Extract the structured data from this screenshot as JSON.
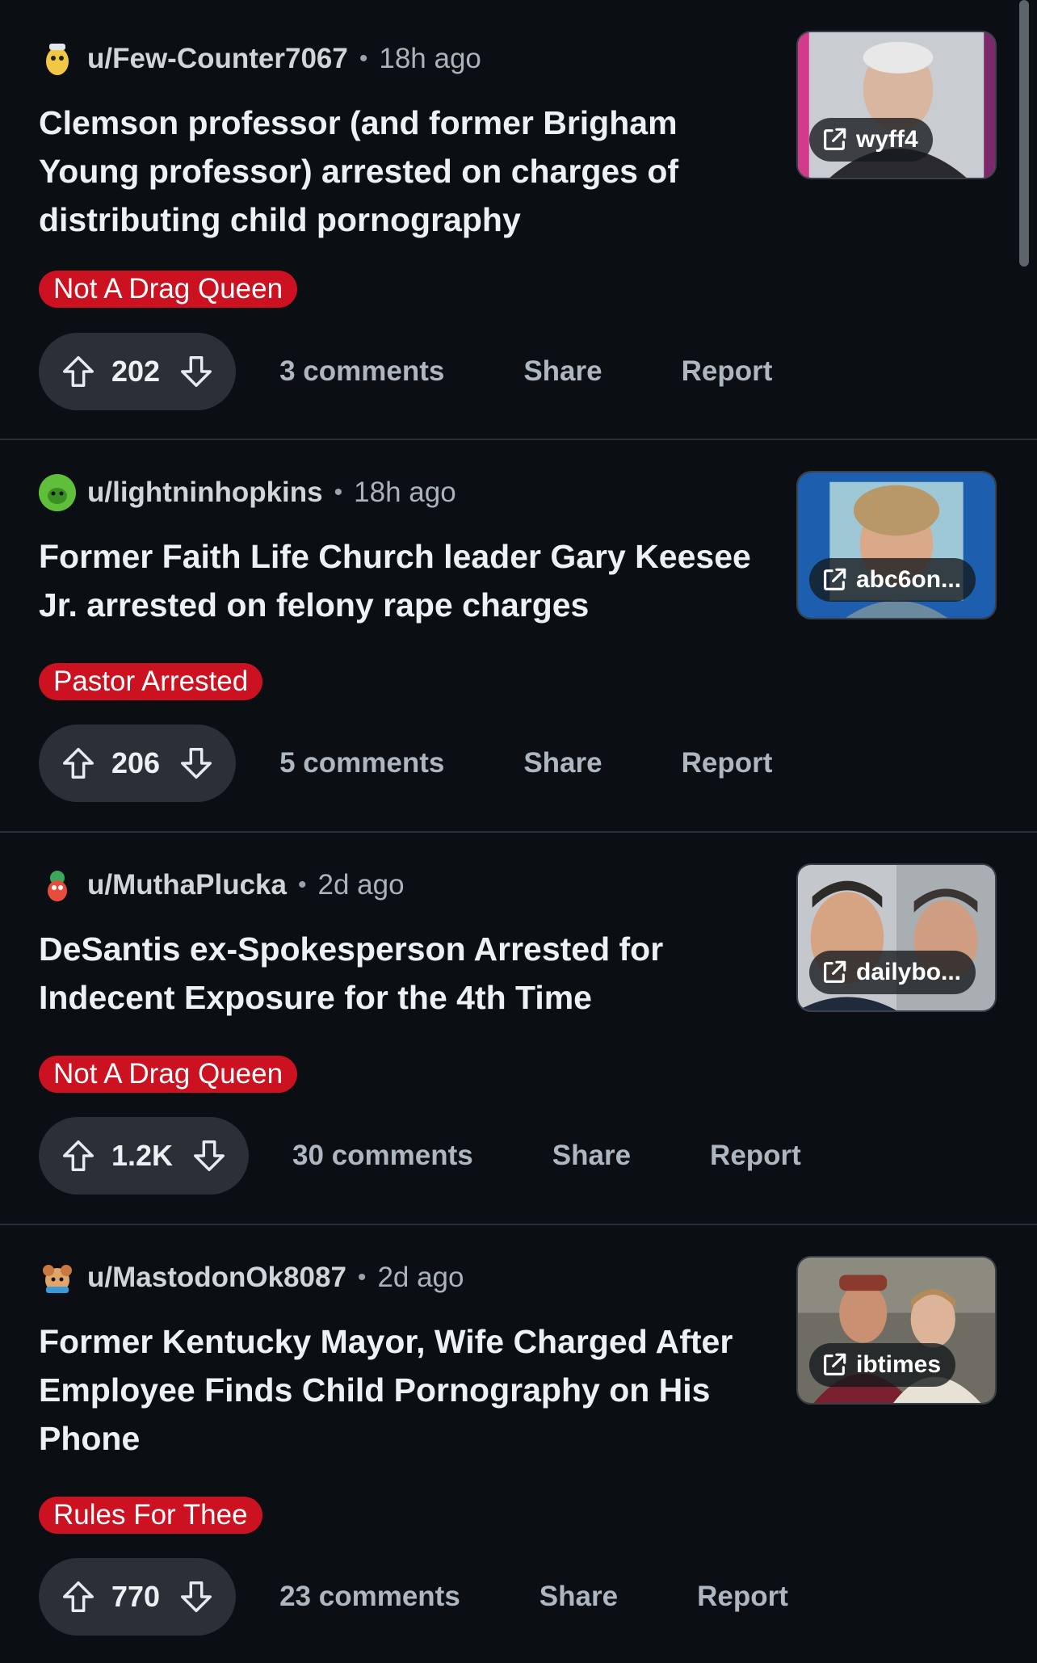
{
  "posts": [
    {
      "username": "u/Few-Counter7067",
      "time": "18h ago",
      "title": "Clemson professor (and former Brigham Young professor) arrested on charges of distributing child pornography",
      "flair": "Not A Drag Queen",
      "score": "202",
      "comments": "3 comments",
      "share": "Share",
      "report": "Report",
      "source": "wyff4"
    },
    {
      "username": "u/lightninhopkins",
      "time": "18h ago",
      "title": "Former Faith Life Church leader Gary Keesee Jr. arrested on felony rape charges",
      "flair": "Pastor Arrested",
      "score": "206",
      "comments": "5 comments",
      "share": "Share",
      "report": "Report",
      "source": "abc6on..."
    },
    {
      "username": "u/MuthaPlucka",
      "time": "2d ago",
      "title": "DeSantis ex-Spokesperson Arrested for Indecent Exposure for the 4th Time",
      "flair": "Not A Drag Queen",
      "score": "1.2K",
      "comments": "30 comments",
      "share": "Share",
      "report": "Report",
      "source": "dailybo..."
    },
    {
      "username": "u/MastodonOk8087",
      "time": "2d ago",
      "title": "Former Kentucky Mayor, Wife Charged After Employee Finds Child Pornography on His Phone",
      "flair": "Rules For Thee",
      "score": "770",
      "comments": "23 comments",
      "share": "Share",
      "report": "Report",
      "source": "ibtimes"
    }
  ],
  "colors": {
    "background": "#0b0e12",
    "flair": "#cc1221",
    "vote_pill": "#2b3036",
    "muted_text": "#aeb7c0"
  },
  "icons": [
    "upvote-icon",
    "downvote-icon",
    "external-link-icon",
    "avatar-icon"
  ]
}
